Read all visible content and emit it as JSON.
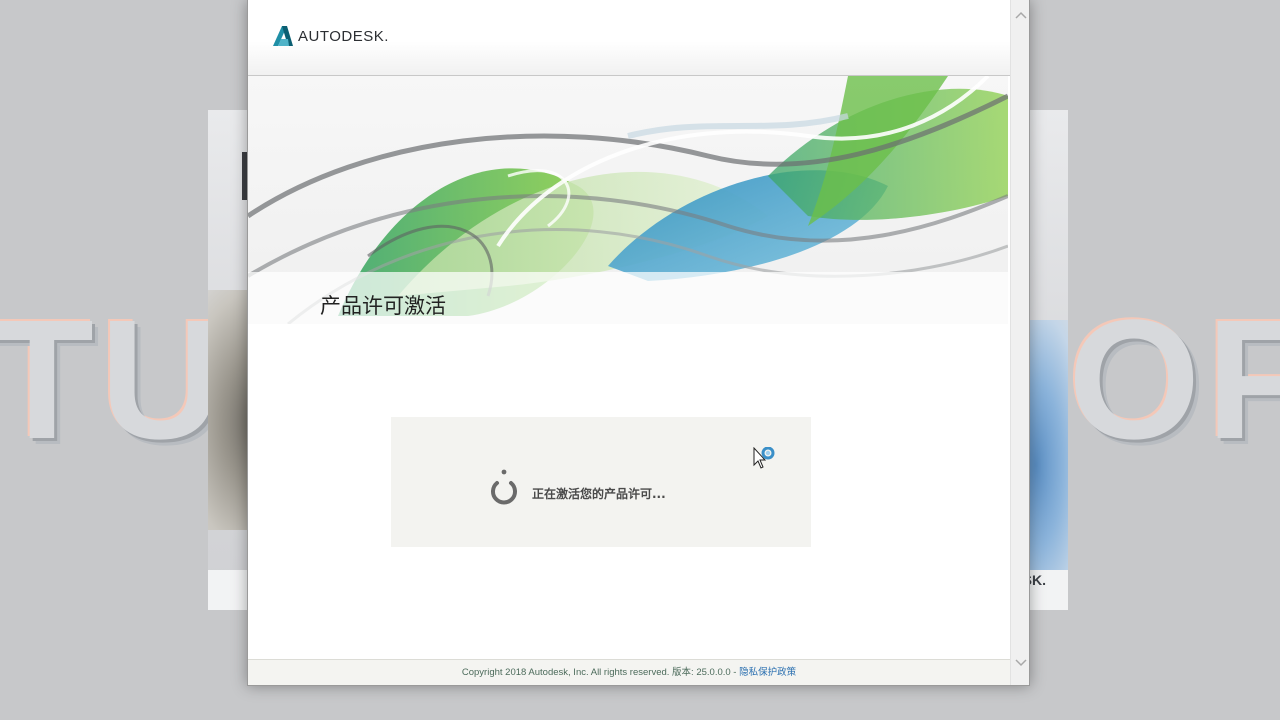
{
  "background": {
    "word_left": "TU",
    "word_right": "OF",
    "splash_logo_partial": "SK."
  },
  "header": {
    "brand": "AUTODESK."
  },
  "banner": {
    "title": "产品许可激活"
  },
  "status": {
    "message": "正在激活您的产品许可..."
  },
  "footer": {
    "copyright": "Copyright 2018 Autodesk, Inc. All rights reserved. 版本: 25.0.0.0 - ",
    "privacy_link": "隐私保护政策"
  },
  "colors": {
    "brand_teal": "#1f8fa6",
    "brand_green": "#7fbf3f",
    "link": "#2a6fb0",
    "panel": "#f3f3f0"
  },
  "icons": {
    "logo": "autodesk-logo-icon",
    "spinner": "loading-spinner-icon",
    "cursor": "busy-cursor-icon",
    "scroll_up": "chevron-up-icon",
    "scroll_down": "chevron-down-icon"
  }
}
